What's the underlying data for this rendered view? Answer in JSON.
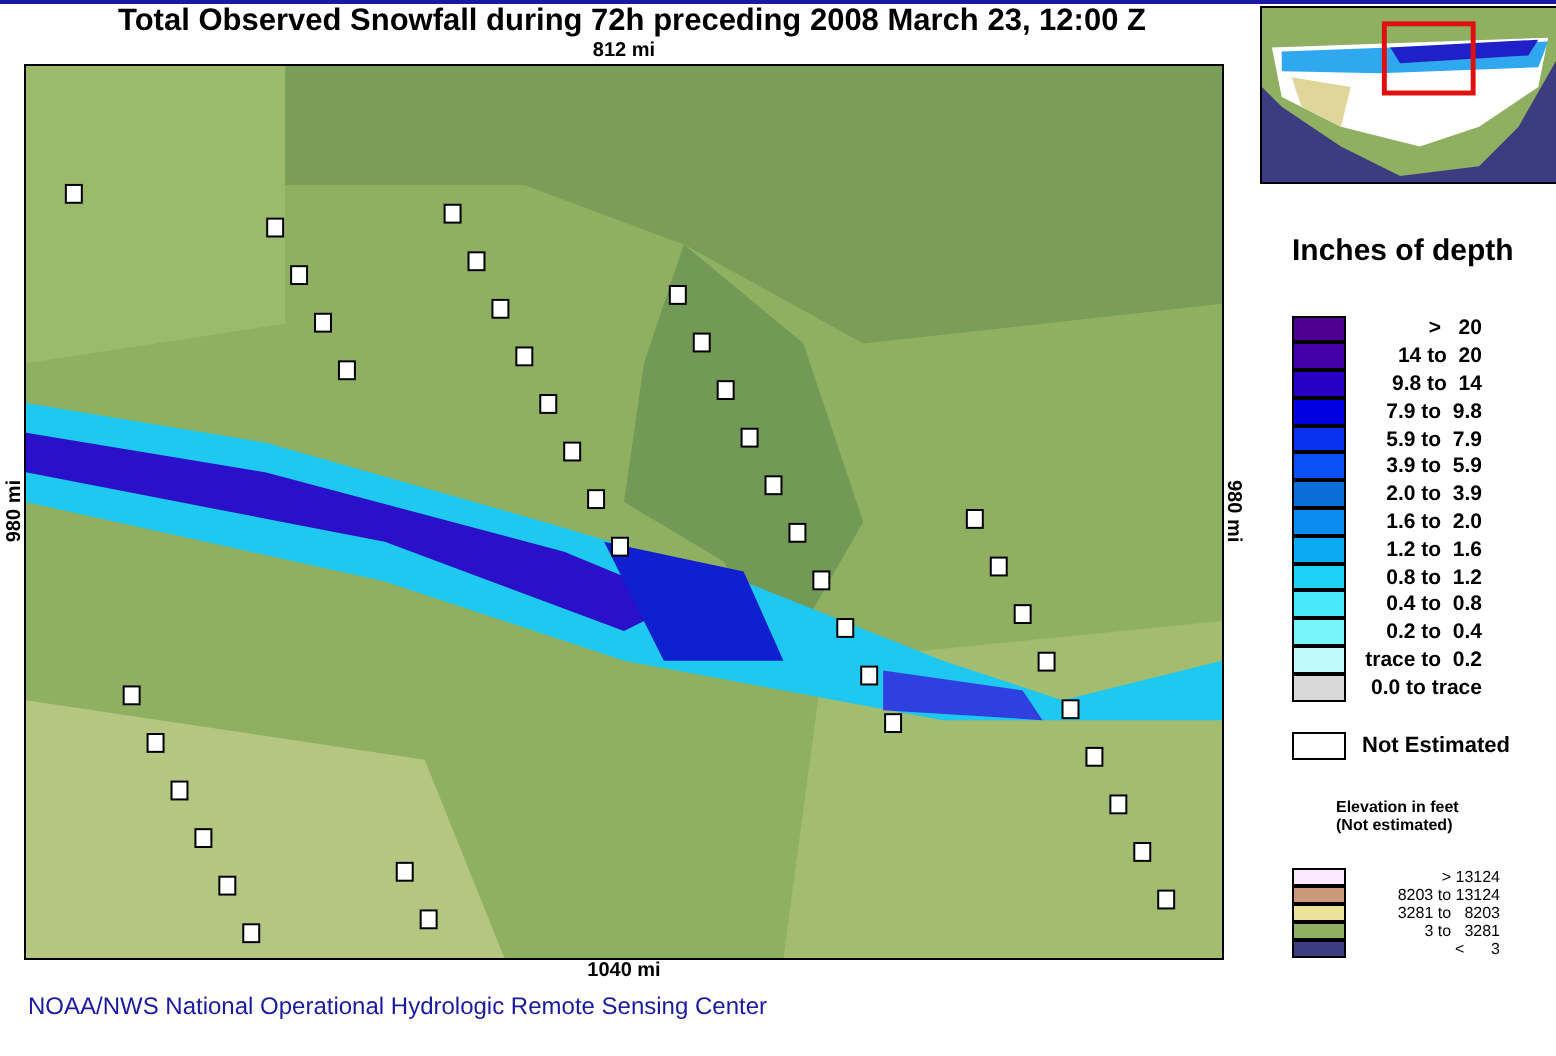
{
  "title": "Total Observed Snowfall during 72h preceding 2008 March 23, 12:00 Z",
  "map": {
    "kind": "picture",
    "top_label": "812 mi",
    "bottom_label": "1040 mi",
    "left_label": "980 mi",
    "right_label": "980 mi"
  },
  "footer_link": "NOAA/NWS National Operational Hydrologic Remote Sensing Center",
  "depth_legend": {
    "title": "Inches of depth",
    "items": [
      {
        "label": ">   20",
        "color": "#4e0090"
      },
      {
        "label": "14 to  20",
        "color": "#4100a8"
      },
      {
        "label": "9.8 to  14",
        "color": "#2800c4"
      },
      {
        "label": "7.9 to  9.8",
        "color": "#0000e0"
      },
      {
        "label": "5.9 to  7.9",
        "color": "#0a30f0"
      },
      {
        "label": "3.9 to  5.9",
        "color": "#0a50f5"
      },
      {
        "label": "2.0 to  3.9",
        "color": "#0a6ed8"
      },
      {
        "label": "1.6 to  2.0",
        "color": "#0a8cf0"
      },
      {
        "label": "1.2 to  1.6",
        "color": "#0aaaf5"
      },
      {
        "label": "0.8 to  1.2",
        "color": "#1ed2f5"
      },
      {
        "label": "0.4 to  0.8",
        "color": "#46e8fa"
      },
      {
        "label": "0.2 to  0.4",
        "color": "#78f5fa"
      },
      {
        "label": "trace to  0.2",
        "color": "#c0fafa"
      },
      {
        "label": "0.0 to trace",
        "color": "#d8d8d8"
      }
    ]
  },
  "not_estimated": {
    "label": "Not Estimated",
    "color": "#ffffff"
  },
  "elevation_legend": {
    "title": "Elevation in feet",
    "subtitle": "(Not estimated)",
    "items": [
      {
        "label": "> 13124",
        "color": "#fbe8fb"
      },
      {
        "label": "8203 to 13124",
        "color": "#c9997a"
      },
      {
        "label": "3281 to   8203",
        "color": "#ece29a"
      },
      {
        "label": "3 to   3281",
        "color": "#8fb060"
      },
      {
        "label": "<      3",
        "color": "#3c3c80"
      }
    ]
  }
}
